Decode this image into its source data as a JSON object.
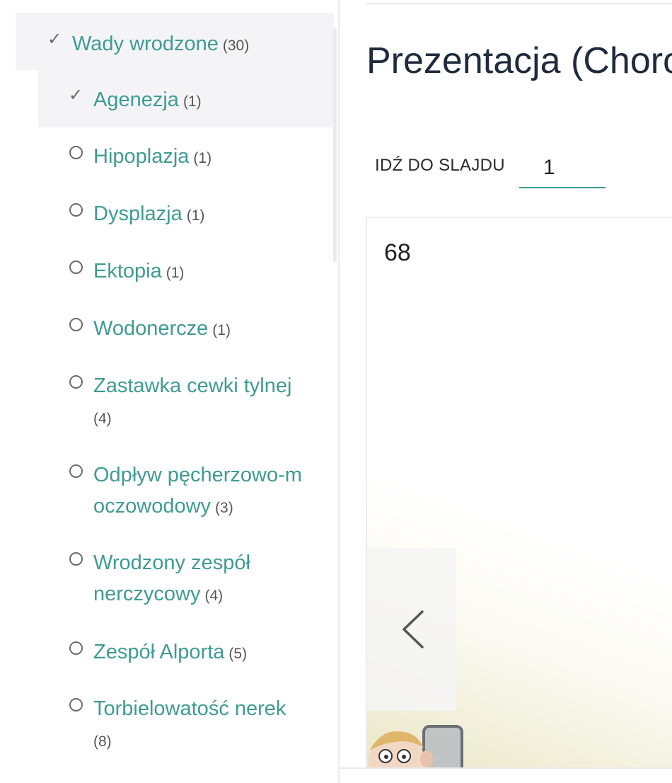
{
  "sidebar": {
    "parent": {
      "label": "Wady wrodzone",
      "count": "(30)",
      "mark": "✓"
    },
    "items": [
      {
        "label": "Agenezja",
        "count": "(1)",
        "mark": "✓"
      },
      {
        "label": "Hipoplazja",
        "count": "(1)"
      },
      {
        "label": "Dysplazja",
        "count": "(1)"
      },
      {
        "label": "Ektopia",
        "count": "(1)"
      },
      {
        "label": "Wodonercze",
        "count": "(1)"
      },
      {
        "label": "Zastawka cewki tylnej",
        "count": "(4)"
      },
      {
        "label": "Odpływ pęcherzowo-moczowodowy",
        "count": "(3)"
      },
      {
        "label": "Wrodzony zespół nerczycowy",
        "count": "(4)"
      },
      {
        "label": "Zespół Alporta",
        "count": "(5)"
      },
      {
        "label": "Torbielowatość nerek",
        "count": "(8)"
      }
    ]
  },
  "main": {
    "title": "Prezentacja (Choro",
    "goto": {
      "label": "IDŹ DO SLAJDU",
      "value": "1"
    },
    "slide": {
      "number": "68"
    }
  },
  "colors": {
    "accent": "#3f9b93",
    "title": "#1f2a3c",
    "active_bg": "#f4f4f6",
    "mark": "#6b6b6b"
  }
}
